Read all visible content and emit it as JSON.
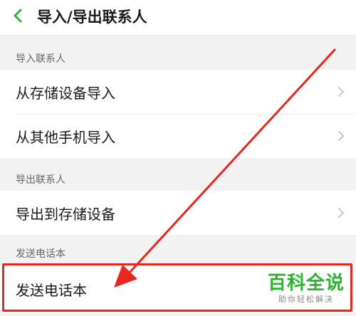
{
  "header": {
    "title": "导入/导出联系人",
    "back_icon": "back-chevron-icon",
    "accent_color": "#2bb42d"
  },
  "sections": [
    {
      "label": "导入联系人",
      "items": [
        {
          "label": "从存储设备导入",
          "icon": "chevron-right-icon"
        },
        {
          "label": "从其他手机导入",
          "icon": "chevron-right-icon"
        }
      ]
    },
    {
      "label": "导出联系人",
      "items": [
        {
          "label": "导出到存储设备",
          "icon": "chevron-right-icon"
        }
      ]
    },
    {
      "label": "发送电话本",
      "items": [
        {
          "label": "发送电话本"
        }
      ]
    }
  ],
  "annotation": {
    "highlight_color": "#e8261d"
  },
  "watermark": {
    "main": "百科全说",
    "sub": "助你轻松解决"
  }
}
